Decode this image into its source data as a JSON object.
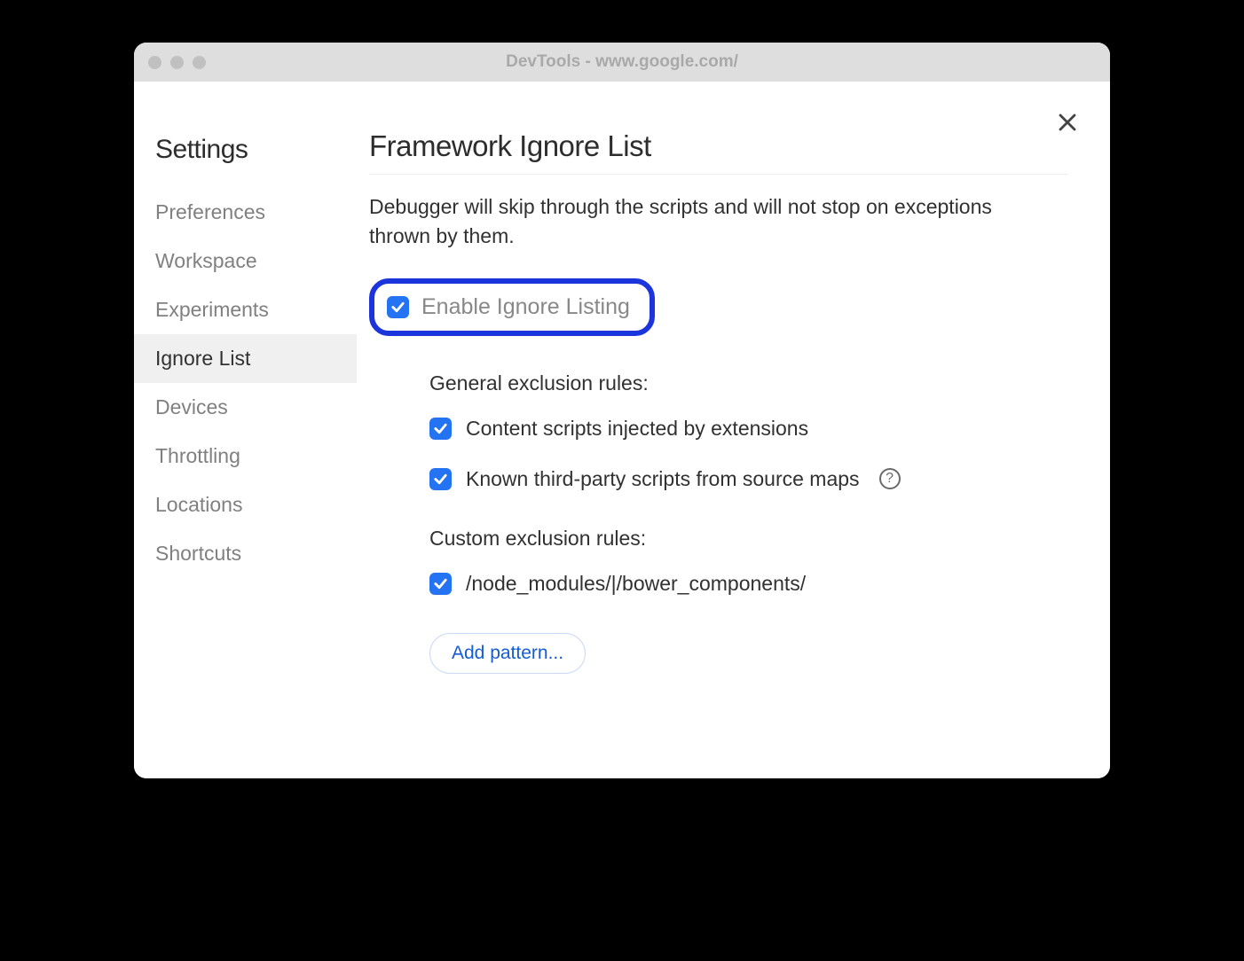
{
  "window": {
    "title": "DevTools - www.google.com/"
  },
  "sidebar": {
    "title": "Settings",
    "items": [
      {
        "label": "Preferences",
        "active": false
      },
      {
        "label": "Workspace",
        "active": false
      },
      {
        "label": "Experiments",
        "active": false
      },
      {
        "label": "Ignore List",
        "active": true
      },
      {
        "label": "Devices",
        "active": false
      },
      {
        "label": "Throttling",
        "active": false
      },
      {
        "label": "Locations",
        "active": false
      },
      {
        "label": "Shortcuts",
        "active": false
      }
    ]
  },
  "main": {
    "title": "Framework Ignore List",
    "description": "Debugger will skip through the scripts and will not stop on exceptions thrown by them.",
    "enable_label": "Enable Ignore Listing",
    "general_heading": "General exclusion rules:",
    "general_rules": [
      {
        "label": "Content scripts injected by extensions",
        "checked": true,
        "help": false
      },
      {
        "label": "Known third-party scripts from source maps",
        "checked": true,
        "help": true
      }
    ],
    "custom_heading": "Custom exclusion rules:",
    "custom_rules": [
      {
        "label": "/node_modules/|/bower_components/",
        "checked": true
      }
    ],
    "add_pattern_label": "Add pattern..."
  }
}
